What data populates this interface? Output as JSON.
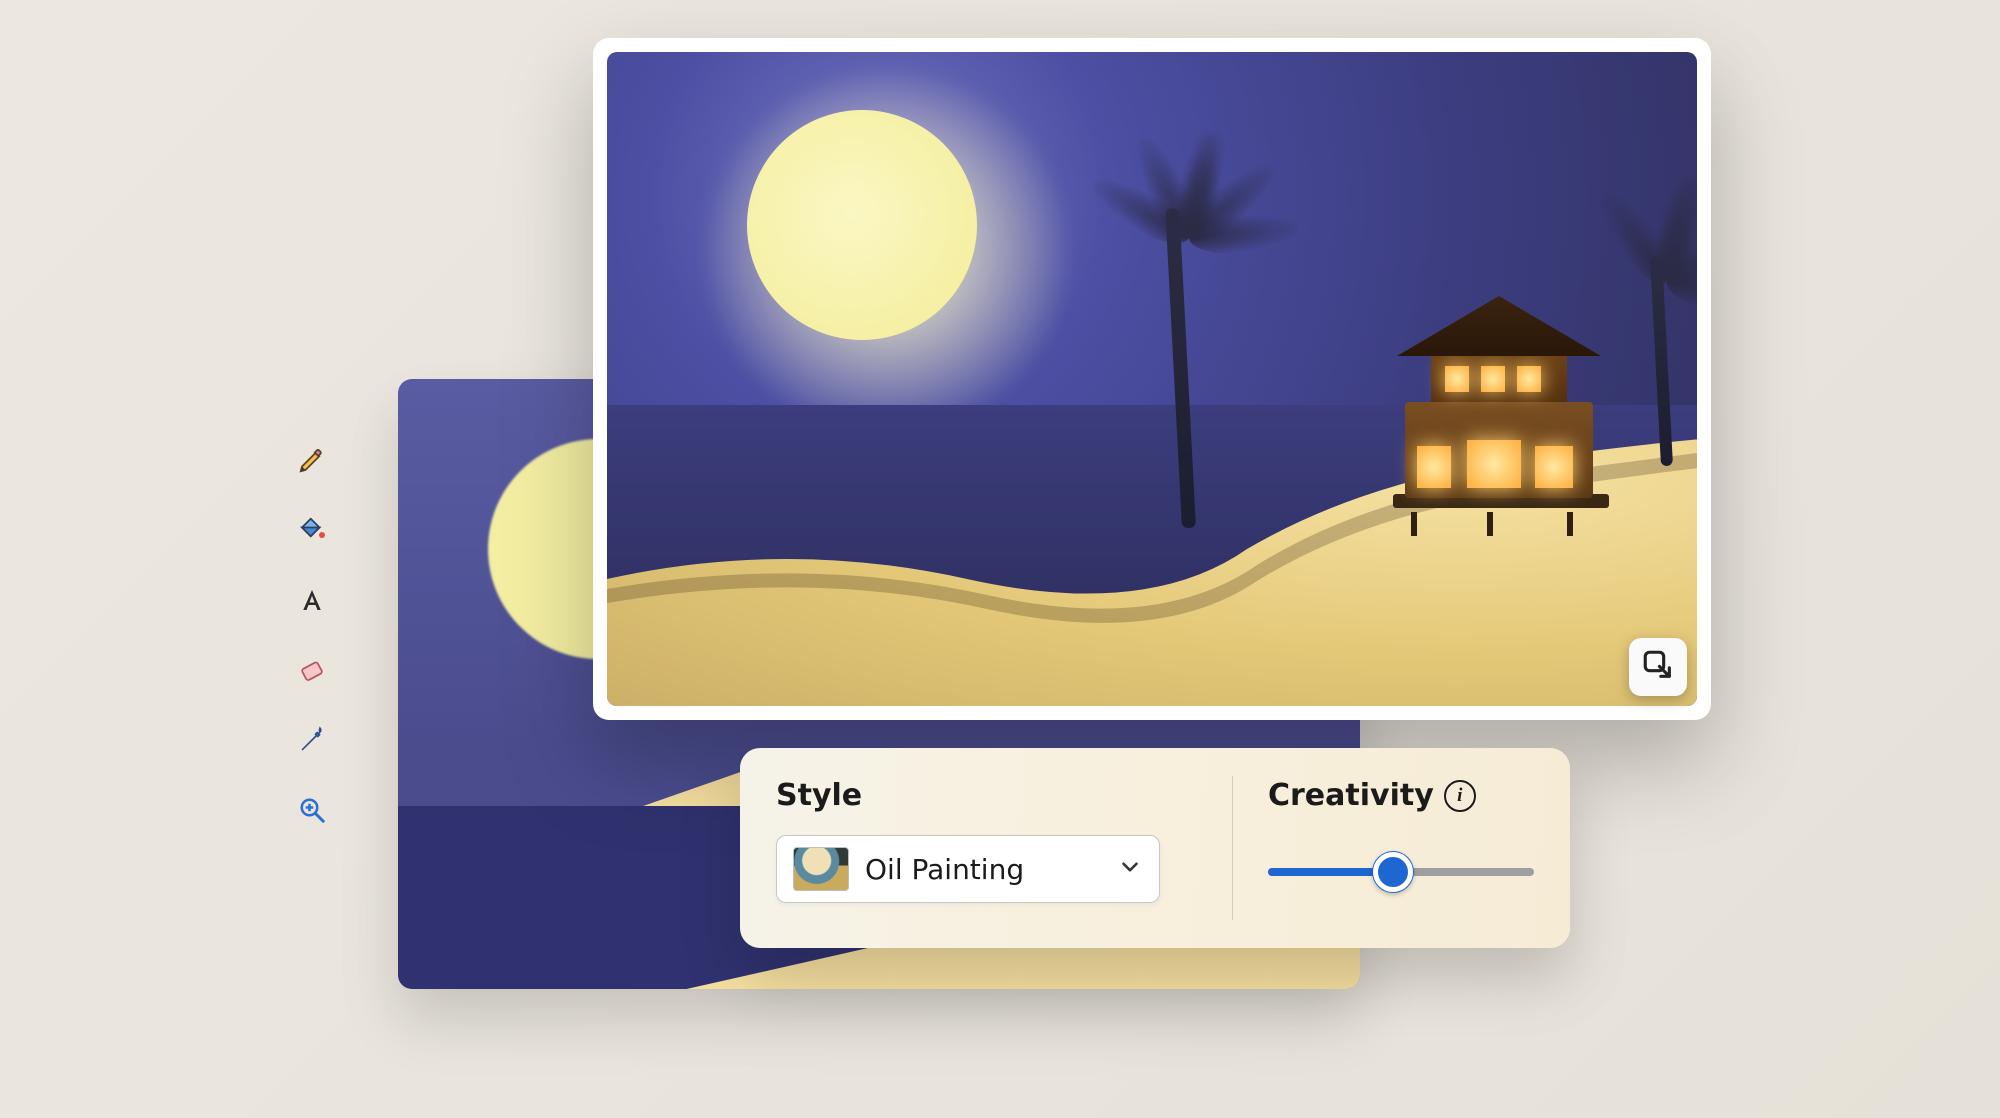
{
  "toolbar": {
    "tools": [
      {
        "id": "pencil",
        "name": "pencil-icon"
      },
      {
        "id": "fill",
        "name": "paint-bucket-icon"
      },
      {
        "id": "text",
        "name": "text-icon"
      },
      {
        "id": "eraser",
        "name": "eraser-icon"
      },
      {
        "id": "eyedrop",
        "name": "eyedropper-icon"
      },
      {
        "id": "zoom",
        "name": "magnifier-icon"
      }
    ]
  },
  "canvas": {
    "description_back": "User sketch: moonlit beach with hut and palm tree",
    "description_front": "AI-rendered oil painting: moonlit beach, cabin, palm trees",
    "expand_tooltip": "Expand"
  },
  "controls": {
    "style": {
      "label": "Style",
      "selected": "Oil Painting"
    },
    "creativity": {
      "label": "Creativity",
      "info_tooltip": "About creativity",
      "value": 47,
      "min": 0,
      "max": 100
    }
  },
  "colors": {
    "accent": "#1e66d0",
    "moon": "#f4ee9e",
    "sky": "#3c3d80",
    "sand": "#f5e1a2"
  }
}
